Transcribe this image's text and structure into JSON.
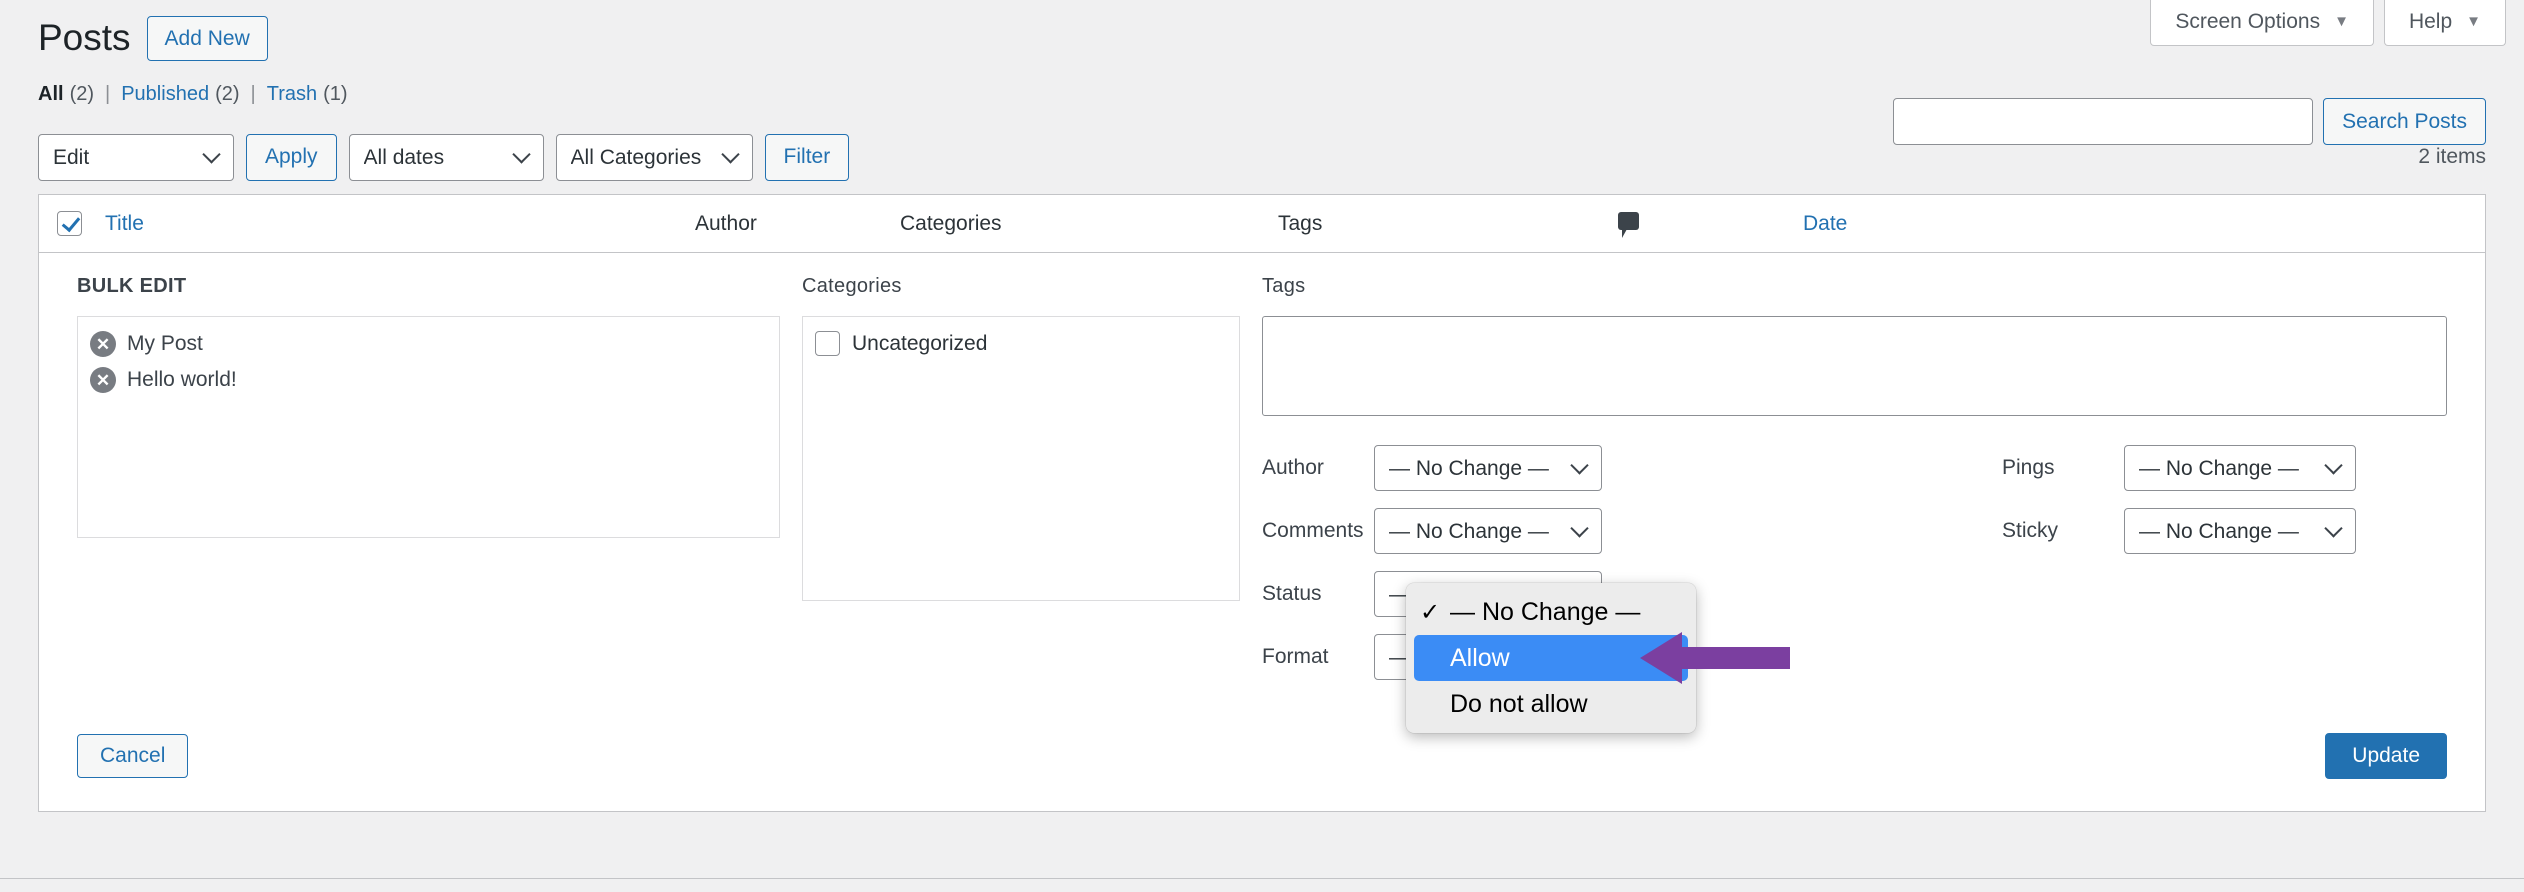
{
  "screen_meta": {
    "screen_options_label": "Screen Options",
    "help_label": "Help",
    "caret": "▼"
  },
  "header": {
    "page_title": "Posts",
    "add_new_label": "Add New"
  },
  "status_links": [
    {
      "label": "All",
      "count": "(2)",
      "current": true
    },
    {
      "label": "Published",
      "count": "(2)",
      "current": false
    },
    {
      "label": "Trash",
      "count": "(1)",
      "current": false
    }
  ],
  "separator": "|",
  "search": {
    "value": "",
    "placeholder": "",
    "button_label": "Search Posts"
  },
  "tablenav": {
    "bulk_action_value": "Edit",
    "apply_label": "Apply",
    "date_filter_value": "All dates",
    "category_filter_value": "All Categories",
    "filter_label": "Filter",
    "items_count": "2 items"
  },
  "table_headers": {
    "title": "Title",
    "author": "Author",
    "categories": "Categories",
    "tags": "Tags",
    "comments_icon": "comment-bubble-icon",
    "date": "Date"
  },
  "bulk_edit": {
    "heading": "BULK EDIT",
    "posts": [
      {
        "title": "My Post",
        "remove_icon": "✕"
      },
      {
        "title": "Hello world!",
        "remove_icon": "✕"
      }
    ],
    "categories_label": "Categories",
    "categories": [
      {
        "label": "Uncategorized",
        "checked": false
      }
    ],
    "tags_label": "Tags",
    "tags_value": "",
    "fields": [
      {
        "label": "Author",
        "value": "— No Change —"
      },
      {
        "label": "Comments",
        "value": "— No Change —"
      },
      {
        "label": "Status",
        "value": "— No Change —"
      },
      {
        "label": "Format",
        "value": "— No Change —"
      }
    ],
    "right_fields": [
      {
        "label": "Pings",
        "value": "— No Change —"
      },
      {
        "label": "Sticky",
        "value": "— No Change —"
      }
    ],
    "cancel_label": "Cancel",
    "update_label": "Update"
  },
  "open_dropdown": {
    "field": "Comments",
    "options": [
      {
        "label": "— No Change —",
        "checked": true,
        "highlighted": false
      },
      {
        "label": "Allow",
        "checked": false,
        "highlighted": true
      },
      {
        "label": "Do not allow",
        "checked": false,
        "highlighted": false
      }
    ],
    "check_glyph": "✓"
  },
  "colors": {
    "accent": "#2271b1",
    "highlight": "#3b8cf5",
    "annotation_arrow": "#7b3fa0",
    "page_bg": "#f0f0f1"
  }
}
